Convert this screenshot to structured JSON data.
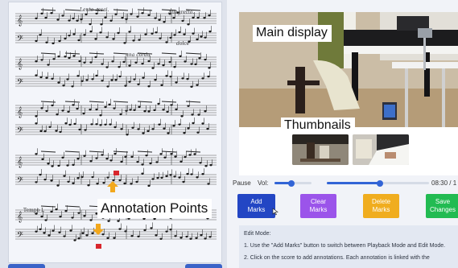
{
  "score": {
    "markings": {
      "lento": "Lento assai.",
      "allegretto": "Allegretto.",
      "dolce": "dolce",
      "una_corda": "una corda",
      "tempo": "Tempo I."
    },
    "annotation_label": "Annotation Points",
    "marker_color": "#d8262d",
    "arrow_color": "#f2a81d"
  },
  "video": {
    "main_label": "Main display",
    "thumbs_label": "Thumbnails"
  },
  "controls": {
    "pause": "Pause",
    "vol": "Vol:",
    "volume_level": 0.45,
    "playback_position": 0.52,
    "time": "08:30 / 1"
  },
  "actions": [
    {
      "line1": "Add",
      "line2": "Marks",
      "color": "#2346c4"
    },
    {
      "line1": "Clear",
      "line2": "Marks",
      "color": "#9b54ea"
    },
    {
      "line1": "Delete",
      "line2": "Marks",
      "color": "#f0ad1f"
    },
    {
      "line1": "Save",
      "line2": "Changes",
      "color": "#22bb52"
    }
  ],
  "info": {
    "heading": "Edit Mode:",
    "line1": "1. Use the \"Add Marks\" button to switch between Playback Mode and Edit Mode.",
    "line2": "2. Click on the score to add annotations. Each annotation is linked with the"
  }
}
